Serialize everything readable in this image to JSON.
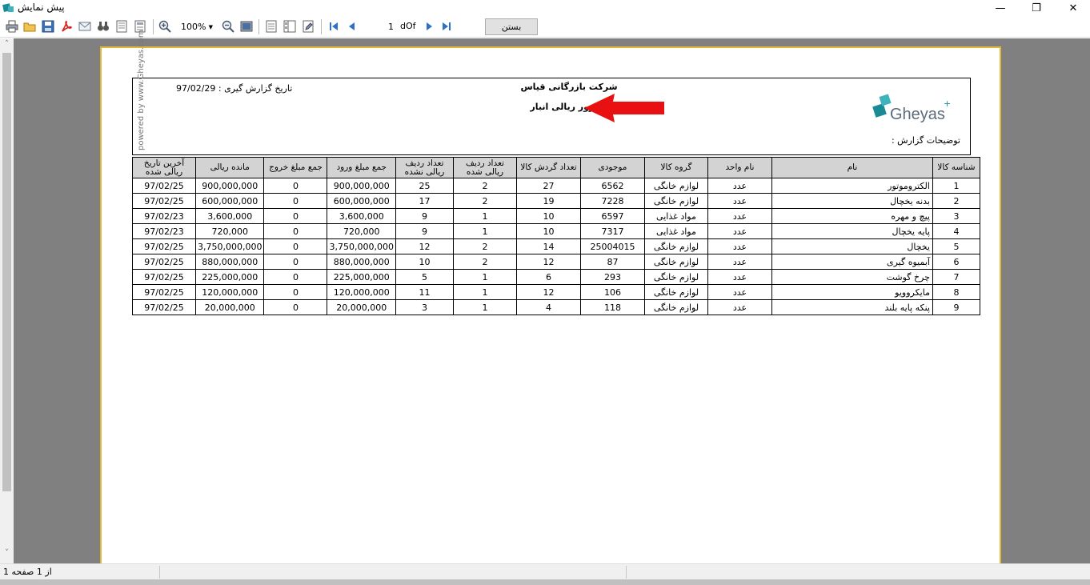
{
  "window": {
    "title": "پیش نمایش",
    "minimize": "—",
    "maximize": "❐",
    "close": "✕"
  },
  "toolbar": {
    "zoom_value": "100%",
    "page_current": "1",
    "page_of": "dOf",
    "close_label": "بستن"
  },
  "report": {
    "company": "شرکت بازرگانی قیاس",
    "title": "مرور ریالی انبار",
    "date_label": "تاریخ گزارش گیری : 97/02/29",
    "powered_by": "powered by www.Gheyas.com",
    "description_label": "توضیحات گزارش :",
    "logo_text": "Gheyas",
    "columns": [
      "شناسه کالا",
      "نام",
      "نام واحد",
      "گروه کالا",
      "موجودی",
      "تعداد گردش کالا",
      "تعداد ردیف ریالی شده",
      "تعداد ردیف ریالی نشده",
      "جمع مبلغ ورود",
      "جمع مبلغ خروج",
      "مانده ریالی",
      "آخرین تاریخ ریالی شده"
    ],
    "rows": [
      [
        "1",
        "الکتروموتور",
        "عدد",
        "لوازم خانگی",
        "6562",
        "27",
        "2",
        "25",
        "900,000,000",
        "0",
        "900,000,000",
        "97/02/25"
      ],
      [
        "2",
        "بدنه یخچال",
        "عدد",
        "لوازم خانگی",
        "7228",
        "19",
        "2",
        "17",
        "600,000,000",
        "0",
        "600,000,000",
        "97/02/25"
      ],
      [
        "3",
        "پیچ و مهره",
        "عدد",
        "مواد غذایی",
        "6597",
        "10",
        "1",
        "9",
        "3,600,000",
        "0",
        "3,600,000",
        "97/02/23"
      ],
      [
        "4",
        "پایه یخچال",
        "عدد",
        "مواد غذایی",
        "7317",
        "10",
        "1",
        "9",
        "720,000",
        "0",
        "720,000",
        "97/02/23"
      ],
      [
        "5",
        "یخچال",
        "عدد",
        "لوازم خانگی",
        "25004015",
        "14",
        "2",
        "12",
        "3,750,000,000",
        "0",
        "3,750,000,000",
        "97/02/25"
      ],
      [
        "6",
        "آبمیوه گیری",
        "عدد",
        "لوازم خانگی",
        "87",
        "12",
        "2",
        "10",
        "880,000,000",
        "0",
        "880,000,000",
        "97/02/25"
      ],
      [
        "7",
        "چرخ گوشت",
        "عدد",
        "لوازم خانگی",
        "293",
        "6",
        "1",
        "5",
        "225,000,000",
        "0",
        "225,000,000",
        "97/02/25"
      ],
      [
        "8",
        "مایکروویو",
        "عدد",
        "لوازم خانگی",
        "106",
        "12",
        "1",
        "11",
        "120,000,000",
        "0",
        "120,000,000",
        "97/02/25"
      ],
      [
        "9",
        "پنکه پایه بلند",
        "عدد",
        "لوازم خانگی",
        "118",
        "4",
        "1",
        "3",
        "20,000,000",
        "0",
        "20,000,000",
        "97/02/25"
      ]
    ]
  },
  "status": {
    "page_text": "از 1 صفحه 1"
  },
  "colors": {
    "page_border": "#e3b73a",
    "canvas": "#808080",
    "header_fill": "#d3d3d3",
    "arrow": "#e81010",
    "logo": "#1a8a94"
  }
}
